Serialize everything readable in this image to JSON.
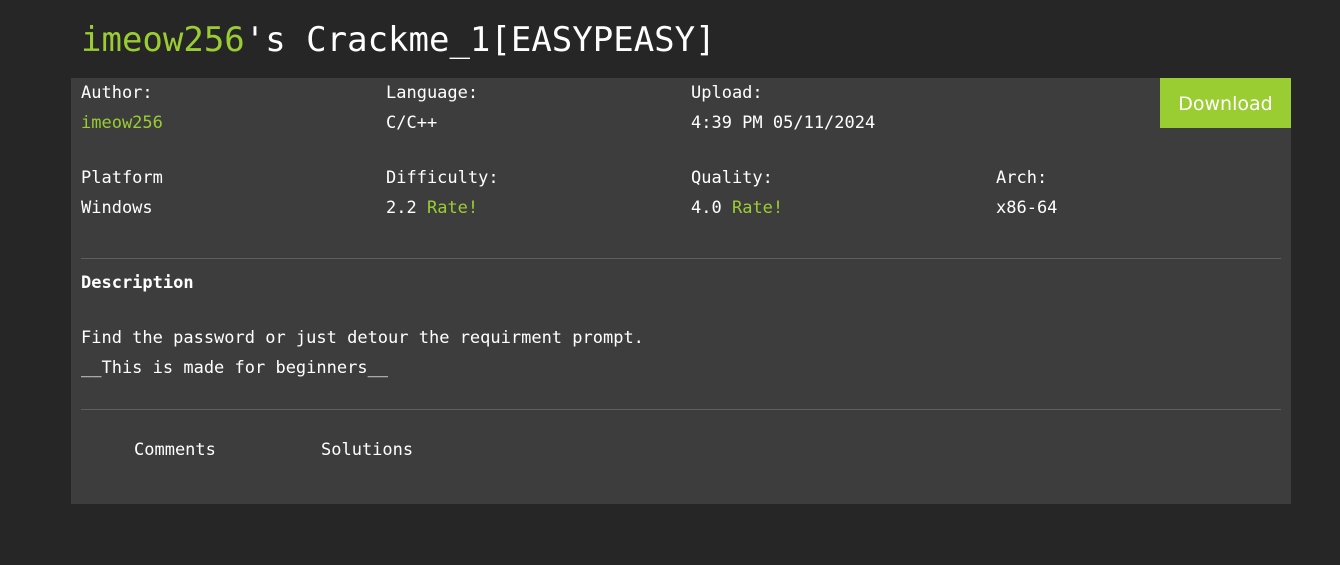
{
  "title": {
    "author_name": "imeow256",
    "suffix": "'s Crackme_1[EASYPEASY]"
  },
  "download_label": "Download",
  "info": {
    "author": {
      "label": "Author:",
      "value": "imeow256"
    },
    "language": {
      "label": "Language:",
      "value": "C/C++"
    },
    "upload": {
      "label": "Upload:",
      "value": "4:39 PM 05/11/2024"
    },
    "platform": {
      "label": "Platform",
      "value": "Windows"
    },
    "difficulty": {
      "label": "Difficulty:",
      "value": "2.2",
      "rate_label": "Rate!"
    },
    "quality": {
      "label": "Quality:",
      "value": "4.0",
      "rate_label": "Rate!"
    },
    "arch": {
      "label": "Arch:",
      "value": "x86-64"
    }
  },
  "description": {
    "heading": "Description",
    "lines": [
      "Find the password or just detour the requirment prompt.",
      "__This is made for beginners__"
    ]
  },
  "tabs": [
    "Comments",
    "Solutions"
  ],
  "colors": {
    "accent": "#9acd32",
    "background": "#262626",
    "card": "#3d3d3d"
  }
}
